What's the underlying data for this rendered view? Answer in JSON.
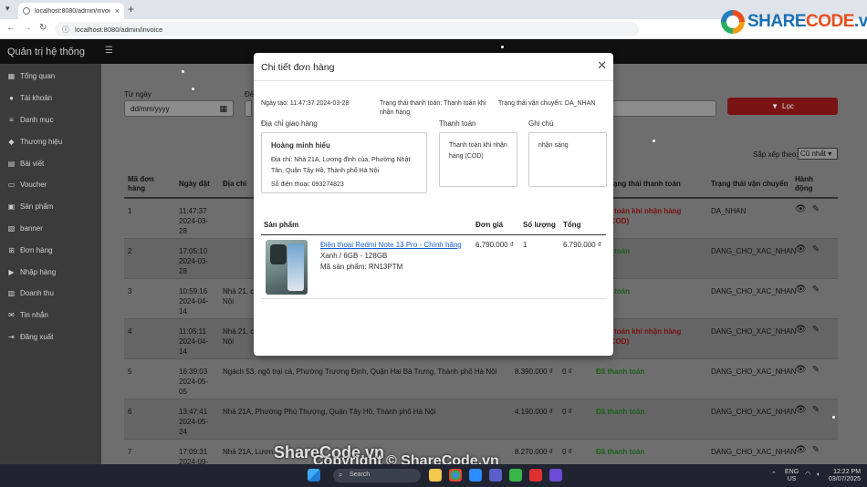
{
  "browser": {
    "tab_title": "localhost:8080/admin/invoice",
    "url": "localhost:8080/admin/invoice"
  },
  "logo": {
    "text_a": "SHARE",
    "text_b": "CODE",
    "text_c": ".vn"
  },
  "app": {
    "brand": "Quản trị hệ thống"
  },
  "sidebar": {
    "items": [
      {
        "label": "Tổng quan",
        "icon": "dashboard-icon"
      },
      {
        "label": "Tài khoản",
        "icon": "user-icon"
      },
      {
        "label": "Danh mục",
        "icon": "list-icon"
      },
      {
        "label": "Thương hiệu",
        "icon": "tag-icon"
      },
      {
        "label": "Bài viết",
        "icon": "article-icon"
      },
      {
        "label": "Voucher",
        "icon": "ticket-icon"
      },
      {
        "label": "Sản phẩm",
        "icon": "box-icon"
      },
      {
        "label": "banner",
        "icon": "image-icon"
      },
      {
        "label": "Đơn hàng",
        "icon": "cart-icon"
      },
      {
        "label": "Nhập hàng",
        "icon": "truck-icon"
      },
      {
        "label": "Doanh thu",
        "icon": "chart-icon"
      },
      {
        "label": "Tin nhắn",
        "icon": "message-icon"
      },
      {
        "label": "Đăng xuất",
        "icon": "logout-icon"
      }
    ]
  },
  "filters": {
    "from_label": "Từ ngày",
    "to_label": "Đế",
    "date_placeholder": "dd/mm/yyyy",
    "filter_button": "Lọc",
    "sort_label": "Sắp xếp theo:",
    "sort_value": "Cũ nhất"
  },
  "table": {
    "headers": {
      "id": "Mã đơn hàng",
      "date": "Ngày đặt",
      "address": "Địa chỉ",
      "pay_status": "ạng thái thanh toán",
      "ship_status": "Trạng thái vận chuyển",
      "actions": "Hành động"
    },
    "rows": [
      {
        "id": "1",
        "time": "11:47:37",
        "date": "2024-03-28",
        "address": "",
        "total": "",
        "ship_fee": "",
        "pay": "h toán khi nhận hàng (COD)",
        "pay_class": "unpaid",
        "ship": "DA_NHAN"
      },
      {
        "id": "2",
        "time": "17:05:10",
        "date": "2024-03-28",
        "address": "",
        "total": "",
        "ship_fee": "",
        "pay": "h toán",
        "pay_class": "paid",
        "ship": "DANG_CHO_XAC_NHAN"
      },
      {
        "id": "3",
        "time": "10:59:16",
        "date": "2024-04-14",
        "address": "Nhà 21, c Nội",
        "total": "",
        "ship_fee": "",
        "pay": "h toán",
        "pay_class": "paid",
        "ship": "DANG_CHO_XAC_NHAN"
      },
      {
        "id": "4",
        "time": "11:05:11",
        "date": "2024-04-14",
        "address": "Nhà 21, c Nội",
        "total": "",
        "ship_fee": "",
        "pay": "h toán khi nhận hàng (COD)",
        "pay_class": "unpaid",
        "ship": "DANG_CHO_XAC_NHAN"
      },
      {
        "id": "5",
        "time": "16:39:03",
        "date": "2024-05-05",
        "address": "Ngách 53, ngõ trại cá, Phường Trương Định, Quận Hai Bà Trưng, Thành phố Hà Nội",
        "total": "8.390.000 ₫",
        "ship_fee": "0 ₫",
        "pay": "Đã thanh toán",
        "pay_class": "paid",
        "ship": "DANG_CHO_XAC_NHAN"
      },
      {
        "id": "6",
        "time": "13:47:41",
        "date": "2024-05-24",
        "address": "Nhà 21A, Phường Phú Thượng, Quận Tây Hồ, Thành phố Hà Nội",
        "total": "4.190.000 ₫",
        "ship_fee": "0 ₫",
        "pay": "Đã thanh toán",
        "pay_class": "paid",
        "ship": "DANG_CHO_XAC_NHAN"
      },
      {
        "id": "7",
        "time": "17:09:31",
        "date": "2024-09-",
        "address": "Nhà 21A, Lươn",
        "total": "8.270.000 ₫",
        "ship_fee": "0 ₫",
        "pay": "Đã thanh toán",
        "pay_class": "paid",
        "ship": "DANG_CHO_XAC_NHAN"
      }
    ]
  },
  "modal": {
    "title": "Chi tiết đơn hàng",
    "created": "Ngày tạo: 11:47:37 2024-03-28",
    "pay_status": "Trạng thái thanh toán: Thanh toán khi nhận hàng",
    "ship_status": "Trạng thái vận chuyển: DA_NHAN",
    "address_title": "Địa chỉ giao hàng",
    "payment_title": "Thanh toán",
    "note_title": "Ghi chú",
    "customer_name": "Hoàng minh hiếu",
    "address": "Địa chỉ: Nhà 21A, Lương đình của, Phường Nhật Tân, Quận Tây Hồ, Thành phố Hà Nội",
    "phone": "Số điện thoại: 093274823",
    "payment_method": "Thanh toán khi nhận hàng (COD)",
    "note": "nhận sáng",
    "product_headers": {
      "product": "Sản phẩm",
      "price": "Đơn giá",
      "qty": "Số lượng",
      "total": "Tổng"
    },
    "product": {
      "name": "Điện thoại Redmi Note 13 Pro - Chính hãng",
      "variant": "Xanh / 6GB - 128GB",
      "sku": "Mã sản phẩm: RN13PTM",
      "price": "6.790.000 ₫",
      "qty": "1",
      "total": "6.790.000 ₫"
    }
  },
  "taskbar": {
    "search": "Search",
    "lang": "ENG",
    "region": "US",
    "time": "12:22 PM",
    "date": "03/07/2025"
  },
  "watermark": {
    "line1": "ShareCode.vn",
    "line2": "Copyright © ShareCode.vn"
  }
}
